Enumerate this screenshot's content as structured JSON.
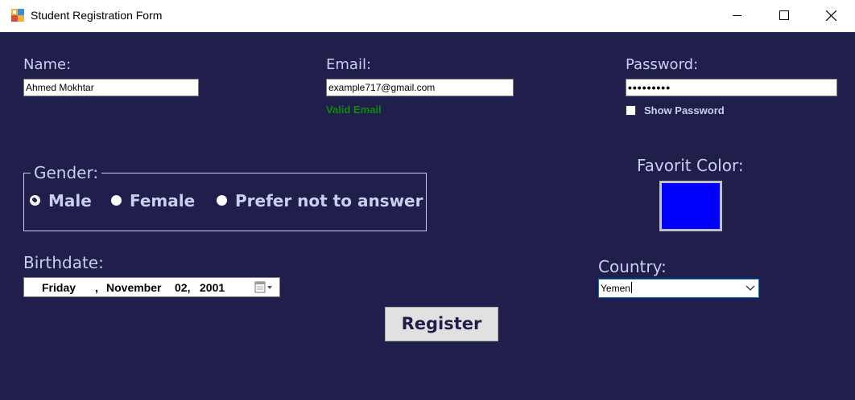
{
  "window": {
    "title": "Student Registration Form",
    "icon": "app-icon",
    "controls": [
      "minimize-icon",
      "maximize-icon",
      "close-icon"
    ]
  },
  "colors": {
    "form_background": "#201e4b",
    "label_text": "#c9cfee",
    "valid_text": "#0f8a0f",
    "favorite_color": "#0000ff"
  },
  "fields": {
    "name": {
      "label": "Name:",
      "value": "Ahmed Mokhtar"
    },
    "email": {
      "label": "Email:",
      "value": "example717@gmail.com",
      "validation": "Valid Email"
    },
    "password": {
      "label": "Password:",
      "masked_value": "•••••••••",
      "show_label": "Show Password",
      "show_checked": false
    }
  },
  "gender": {
    "legend": "Gender:",
    "options": [
      {
        "label": "Male",
        "checked": true
      },
      {
        "label": "Female",
        "checked": false
      },
      {
        "label": "Prefer not to answer",
        "checked": false
      }
    ]
  },
  "favorite_color": {
    "label": "Favorit Color:",
    "value": "#0000ff"
  },
  "birthdate": {
    "label": "Birthdate:",
    "weekday": "Friday",
    "sep": ",",
    "month": "November",
    "day": "02,",
    "year": "2001"
  },
  "country": {
    "label": "Country:",
    "value": "Yemen"
  },
  "register": {
    "label": "Register"
  }
}
